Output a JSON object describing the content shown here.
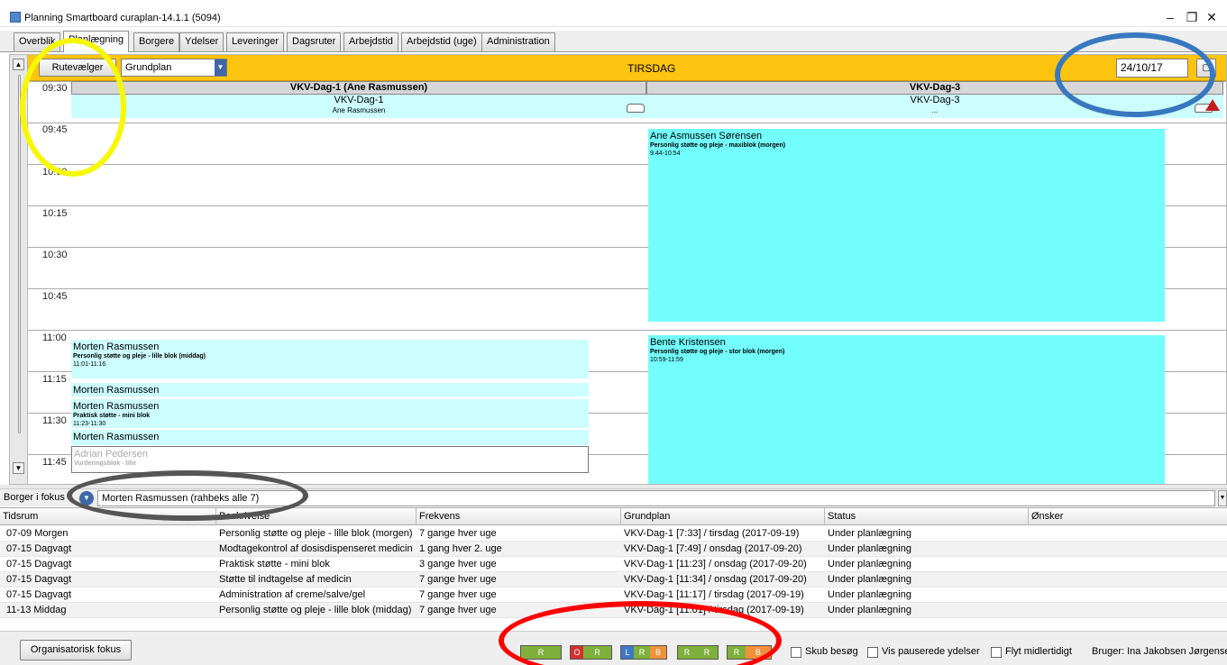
{
  "window": {
    "title": "Planning Smartboard curaplan-14.1.1 (5094)",
    "minimize_glyph": "–",
    "maximize_glyph": "❐",
    "close_glyph": "✕"
  },
  "tabs": [
    {
      "label": "Overblik"
    },
    {
      "label": "Planlægning",
      "active": true
    },
    {
      "label": "Borgere"
    },
    {
      "label": "Ydelser"
    },
    {
      "label": "Leveringer"
    },
    {
      "label": "Dagsruter"
    },
    {
      "label": "Arbejdstid"
    },
    {
      "label": "Arbejdstid (uge)"
    },
    {
      "label": "Administration"
    }
  ],
  "schedule": {
    "rutevaelger_label": "Rutevælger",
    "grundplan_value": "Grundplan",
    "day_title": "TIRSDAG",
    "date": "24/10/17",
    "time_labels": [
      "09:30",
      "09:45",
      "10:00",
      "10:15",
      "10:30",
      "10:45",
      "11:00",
      "11:15",
      "11:30",
      "11:45"
    ],
    "columns": [
      {
        "header": "VKV-Dag-1 (Ane Rasmussen)",
        "route_name": "VKV-Dag-1",
        "route_sub": "Ane Rasmussen"
      },
      {
        "header": "VKV-Dag-3",
        "route_name": "VKV-Dag-3",
        "route_sub": "..."
      }
    ],
    "col1_visits": [
      {
        "name": "Morten Rasmussen",
        "desc": "Personlig støtte og pleje - lille blok (middag)",
        "time": "11:01-11:16"
      },
      {
        "name": "Morten Rasmussen"
      },
      {
        "name": "Morten Rasmussen",
        "desc": "Praktisk støtte - mini blok",
        "time": "11:23-11:30"
      },
      {
        "name": "Morten Rasmussen"
      },
      {
        "name": "Adrian Pedersen",
        "desc": "Vurderingsblok - lille",
        "time": "11:45-12:00"
      }
    ],
    "col2_visits": [
      {
        "name": "Ane Asmussen Sørensen",
        "desc": "Personlig støtte og pleje - maxiblok (morgen)",
        "time": "9:44-10:54"
      },
      {
        "name": "Bente Kristensen",
        "desc": "Personlig støtte og pleje - stor blok (morgen)",
        "time": "10:59-11:59"
      }
    ]
  },
  "focus": {
    "label": "Borger i fokus",
    "value": "Morten Rasmussen (rahbeks alle 7)"
  },
  "grid": {
    "headers": [
      "Tidsrum",
      "Beskrivelse",
      "Frekvens",
      "Grundplan",
      "Status",
      "Ønsker"
    ],
    "rows": [
      [
        "07-09 Morgen",
        "Personlig støtte og pleje - lille blok (morgen)",
        "7 gange hver uge",
        "VKV-Dag-1 [7:33] / tirsdag (2017-09-19)",
        "Under planlægning",
        ""
      ],
      [
        "07-15 Dagvagt",
        "Modtagekontrol af dosisdispenseret medicin",
        "1 gang hver 2. uge",
        "VKV-Dag-1 [7:49] / onsdag (2017-09-20)",
        "Under planlægning",
        ""
      ],
      [
        "07-15 Dagvagt",
        "Praktisk støtte - mini blok",
        "3 gange hver uge",
        "VKV-Dag-1 [11:23] / onsdag (2017-09-20)",
        "Under planlægning",
        ""
      ],
      [
        "07-15 Dagvagt",
        "Støtte til indtagelse af medicin",
        "7 gange hver uge",
        "VKV-Dag-1 [11:34] / onsdag (2017-09-20)",
        "Under planlægning",
        ""
      ],
      [
        "07-15 Dagvagt",
        "Administration af creme/salve/gel",
        "7 gange hver uge",
        "VKV-Dag-1 [11:17] / tirsdag (2017-09-19)",
        "Under planlægning",
        ""
      ],
      [
        "11-13 Middag",
        "Personlig støtte og pleje - lille blok (middag)",
        "7 gange hver uge",
        "VKV-Dag-1 [11:01] / tirsdag (2017-09-19)",
        "Under planlægning",
        ""
      ]
    ]
  },
  "bottom": {
    "org_button": "Organisatorisk fokus",
    "status_buttons": [
      {
        "parts": [
          {
            "t": "R",
            "c": "#7fb03c"
          }
        ]
      },
      {
        "parts": [
          {
            "t": "O",
            "c": "#d32f2f"
          },
          {
            "t": "R",
            "c": "#7fb03c"
          }
        ]
      },
      {
        "parts": [
          {
            "t": "L",
            "c": "#3f77c8"
          },
          {
            "t": "R",
            "c": "#7fb03c"
          },
          {
            "t": "B",
            "c": "#f0913a"
          }
        ]
      },
      {
        "parts": [
          {
            "t": "R",
            "c": "#7fb03c"
          },
          {
            "t": "R",
            "c": "#7fb03c"
          }
        ]
      },
      {
        "parts": [
          {
            "t": "R",
            "c": "#7fb03c"
          },
          {
            "t": "B",
            "c": "#f0913a"
          }
        ]
      }
    ],
    "checkboxes": [
      "Skub besøg",
      "Vis pauserede ydelser",
      "Flyt midlertidigt"
    ],
    "user": "Bruger: Ina Jakobsen Jørgensen"
  },
  "colors": {
    "header_orange": "#fec40f",
    "visit_light": "#ccfeff",
    "visit_cyan": "#73fefe",
    "annotation_yellow": "#f7f700",
    "annotation_blue": "#3878c0",
    "annotation_gray": "#555555",
    "annotation_red": "#ff0000"
  }
}
